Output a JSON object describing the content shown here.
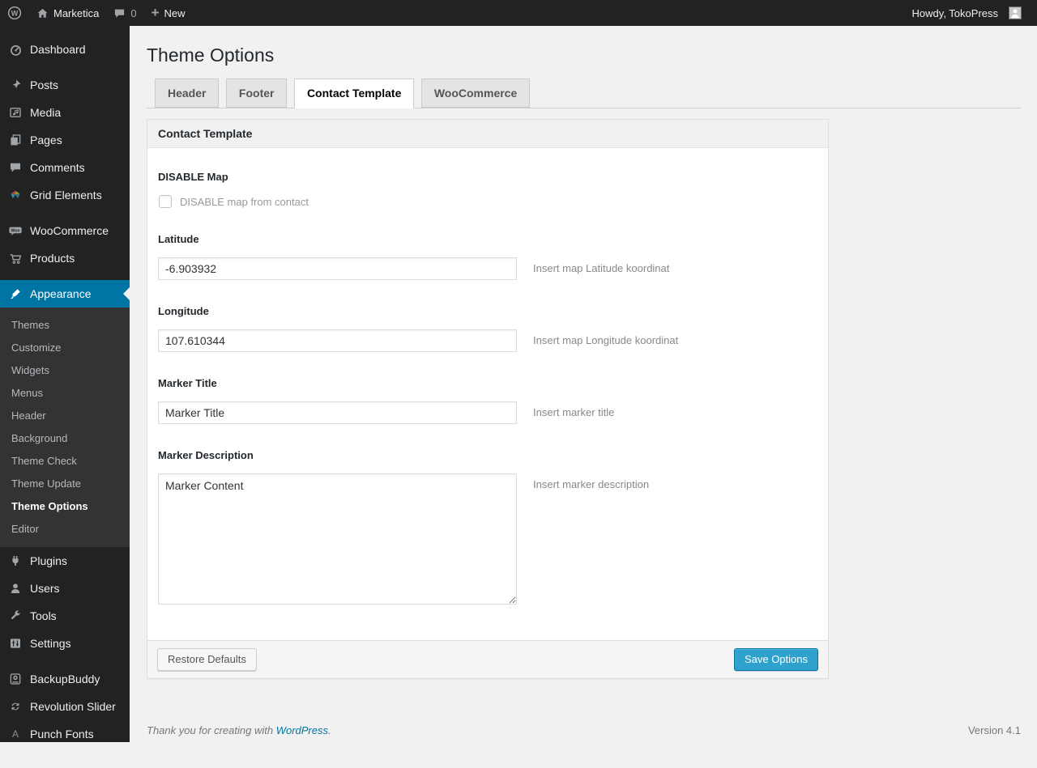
{
  "colors": {
    "admin_bar_bg": "#222222",
    "sidebar_bg": "#222222",
    "submenu_bg": "#333333",
    "highlight_blue": "#0074a2",
    "primary_button_bg": "#2ea2cc",
    "content_bg": "#f1f1f1",
    "icon_gray": "#a0a5aa"
  },
  "admin_bar": {
    "wp_logo_icon": "wordpress-logo-icon",
    "site_name": "Marketica",
    "comments_icon": "comment-bubble-icon",
    "comments_count": "0",
    "new_label": "New",
    "howdy": "Howdy, TokoPress",
    "avatar_icon": "user-avatar"
  },
  "sidebar": {
    "items": [
      {
        "label": "Dashboard",
        "icon": "dashboard-icon"
      },
      {
        "label": "Posts",
        "icon": "pin-icon"
      },
      {
        "label": "Media",
        "icon": "media-icon"
      },
      {
        "label": "Pages",
        "icon": "pages-icon"
      },
      {
        "label": "Comments",
        "icon": "comments-icon"
      },
      {
        "label": "Grid Elements",
        "icon": "grid-elements-icon"
      },
      {
        "label": "WooCommerce",
        "icon": "woocommerce-icon"
      },
      {
        "label": "Products",
        "icon": "cart-icon"
      },
      {
        "label": "Appearance",
        "icon": "appearance-icon",
        "active": true
      },
      {
        "label": "Plugins",
        "icon": "plugins-icon"
      },
      {
        "label": "Users",
        "icon": "users-icon"
      },
      {
        "label": "Tools",
        "icon": "tools-icon"
      },
      {
        "label": "Settings",
        "icon": "settings-icon"
      },
      {
        "label": "BackupBuddy",
        "icon": "backupbuddy-icon"
      },
      {
        "label": "Revolution Slider",
        "icon": "revolution-slider-icon"
      },
      {
        "label": "Punch Fonts",
        "icon": "punch-fonts-icon"
      }
    ],
    "appearance_submenu": [
      {
        "label": "Themes"
      },
      {
        "label": "Customize"
      },
      {
        "label": "Widgets"
      },
      {
        "label": "Menus"
      },
      {
        "label": "Header"
      },
      {
        "label": "Background"
      },
      {
        "label": "Theme Check"
      },
      {
        "label": "Theme Update"
      },
      {
        "label": "Theme Options",
        "current": true
      },
      {
        "label": "Editor"
      }
    ]
  },
  "page": {
    "title": "Theme Options",
    "tabs": [
      {
        "label": "Header"
      },
      {
        "label": "Footer"
      },
      {
        "label": "Contact Template",
        "active": true
      },
      {
        "label": "WooCommerce"
      }
    ],
    "panel": {
      "header": "Contact Template",
      "fields": [
        {
          "type": "checkbox",
          "label": "DISABLE Map",
          "checkbox_label": "DISABLE map from contact",
          "checked": false
        },
        {
          "type": "text",
          "label": "Latitude",
          "value": "-6.903932",
          "hint": "Insert map Latitude koordinat"
        },
        {
          "type": "text",
          "label": "Longitude",
          "value": "107.610344",
          "hint": "Insert map Longitude koordinat"
        },
        {
          "type": "text",
          "label": "Marker Title",
          "value": "Marker Title",
          "hint": "Insert marker title"
        },
        {
          "type": "textarea",
          "label": "Marker Description",
          "value": "Marker Content",
          "hint": "Insert marker description"
        }
      ],
      "restore_label": "Restore Defaults",
      "save_label": "Save Options"
    },
    "footer": {
      "thanks_prefix": "Thank you for creating with",
      "link_label": "WordPress",
      "suffix": ".",
      "version": "Version 4.1"
    }
  }
}
